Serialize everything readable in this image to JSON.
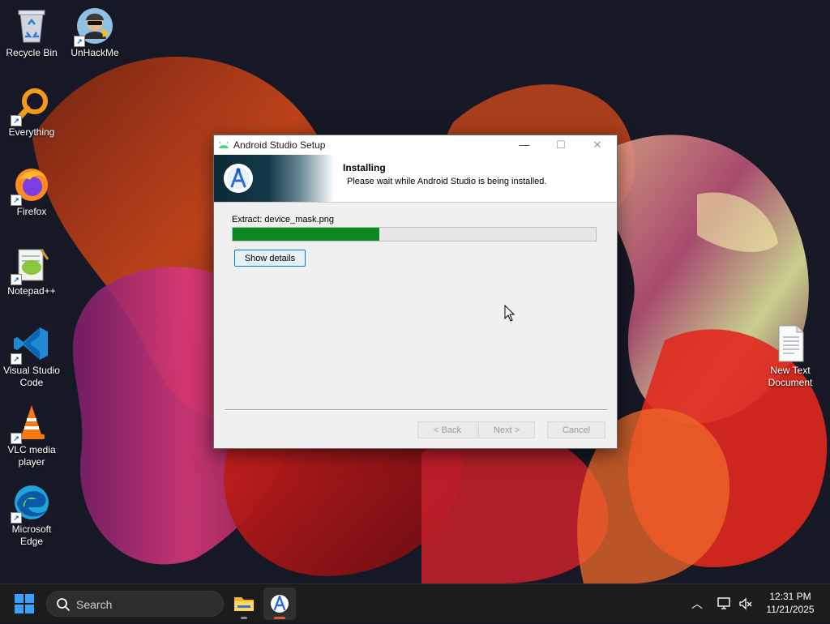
{
  "desktop": {
    "icons": [
      {
        "label": "Recycle Bin"
      },
      {
        "label": "UnHackMe"
      },
      {
        "label": "Everything"
      },
      {
        "label": "Firefox"
      },
      {
        "label": "Notepad++"
      },
      {
        "label": "Visual Studio Code"
      },
      {
        "label": "VLC media player"
      },
      {
        "label": "Microsoft Edge"
      },
      {
        "label": "New Text Document"
      }
    ]
  },
  "dialog": {
    "title": "Android Studio Setup",
    "window_buttons": {
      "minimize": "—",
      "maximize": "☐",
      "close": "✕"
    },
    "header": {
      "heading": "Installing",
      "subheading": "Please wait while Android Studio is being installed."
    },
    "status": "Extract: device_mask.png",
    "progress_fraction": 0.405,
    "show_details_label": "Show details",
    "buttons": {
      "back": "< Back",
      "next": "Next >",
      "cancel": "Cancel"
    }
  },
  "taskbar": {
    "search_placeholder": "Search",
    "apps": [
      "File Explorer",
      "Android Studio Setup"
    ],
    "clock": {
      "time": "12:31 PM",
      "date": "11/21/2025"
    }
  },
  "colors": {
    "progress_fill": "#0b8a1f",
    "accent": "#0078d7",
    "taskbar_bg": "#1c1c1c"
  }
}
